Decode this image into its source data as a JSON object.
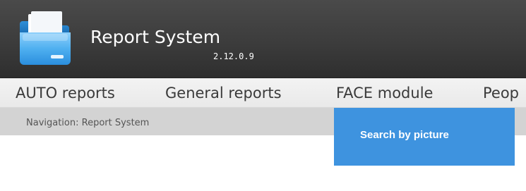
{
  "header": {
    "logo_icon": "folder-icon",
    "title": "Report System",
    "version": "2.12.0.9"
  },
  "menu": {
    "items": [
      {
        "label": "AUTO reports"
      },
      {
        "label": "General reports"
      },
      {
        "label": "FACE module"
      },
      {
        "label": "Peop"
      }
    ]
  },
  "breadcrumb": {
    "text": "Navigation: Report System"
  },
  "dropdown": {
    "items": [
      {
        "label": "Search by picture"
      }
    ]
  },
  "colors": {
    "header_bg": "#3c3c3c",
    "menu_bg": "#efefef",
    "breadcrumb_bg": "#d3d3d3",
    "dropdown_bg": "#3e93df"
  }
}
